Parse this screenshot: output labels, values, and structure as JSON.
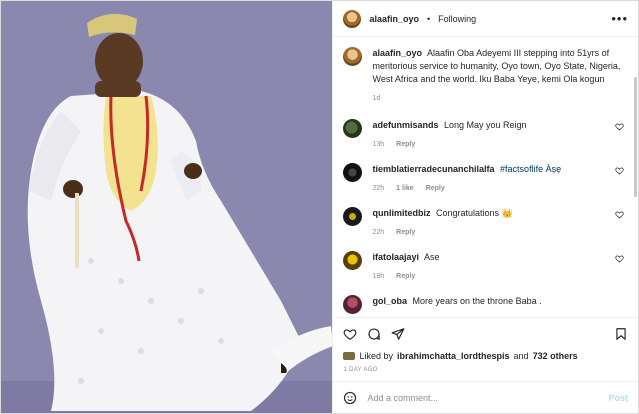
{
  "post": {
    "image_watermark": "",
    "username": "alaafin_oyo",
    "separator": "•",
    "follow_status": "Following",
    "caption": {
      "username": "alaafin_oyo",
      "text": "Alaafin Oba Adeyemi III stepping into 51yrs of meritorious service to humanity, Oyo town, Oyo State, Nigeria, West Africa and the world. Iku Baba Yeye, kemi Ola kogun",
      "age": "1d"
    },
    "comments": [
      {
        "username": "adefunmisands",
        "text": "Long May you Reign",
        "age": "13h",
        "likes": "",
        "reply": "Reply"
      },
      {
        "username": "tiemblatierradecunanchilalfa",
        "text": "#factsoflife Àṣẹ",
        "age": "22h",
        "likes": "1 like",
        "reply": "Reply"
      },
      {
        "username": "qunlimitedbiz",
        "text": "Congratulations 👑",
        "age": "22h",
        "likes": "",
        "reply": "Reply"
      },
      {
        "username": "ifatolaajayi",
        "text": "Ase",
        "age": "18h",
        "likes": "",
        "reply": "Reply"
      },
      {
        "username": "gol_oba",
        "text": "More years on the throne Baba .",
        "age": "",
        "likes": "",
        "reply": ""
      }
    ],
    "liked_by_prefix": "Liked by",
    "liked_by_user": "ibrahimchatta_lordthespis",
    "liked_by_and": "and",
    "liked_by_others": "732 others",
    "posted_ago": "1 DAY AGO",
    "comment_placeholder": "Add a comment...",
    "post_button": "Post"
  },
  "icons": {
    "more": "more-horizontal-icon",
    "heart": "heart-icon",
    "comment": "comment-icon",
    "share": "share-icon",
    "bookmark": "bookmark-icon",
    "emoji": "emoji-icon"
  }
}
